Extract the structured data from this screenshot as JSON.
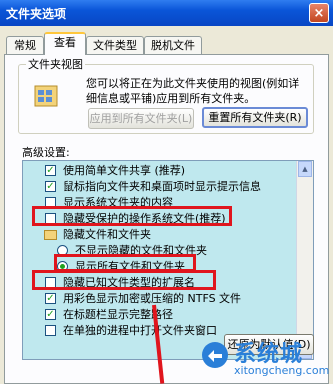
{
  "window": {
    "title": "文件夹选项",
    "close_glyph": "×"
  },
  "tabs": [
    {
      "label": "常规"
    },
    {
      "label": "查看"
    },
    {
      "label": "文件类型"
    },
    {
      "label": "脱机文件"
    }
  ],
  "folder_views": {
    "group_title": "文件夹视图",
    "description": "您可以将正在为此文件夹使用的视图(例如详细信息或平铺)应用到所有文件夹。",
    "apply_button": "应用到所有文件夹(L)",
    "reset_button": "重置所有文件夹(R)"
  },
  "advanced": {
    "label": "高级设置:",
    "items": [
      {
        "type": "checkbox",
        "checked": true,
        "text": "使用简单文件共享 (推荐)"
      },
      {
        "type": "checkbox",
        "checked": true,
        "text": "鼠标指向文件夹和桌面项时显示提示信息"
      },
      {
        "type": "checkbox",
        "checked": false,
        "text": "显示系统文件夹的内容"
      },
      {
        "type": "checkbox",
        "checked": false,
        "text": "隐藏受保护的操作系统文件(推荐)"
      },
      {
        "type": "folder",
        "text": "隐藏文件和文件夹"
      },
      {
        "type": "radio",
        "checked": false,
        "text": "不显示隐藏的文件和文件夹"
      },
      {
        "type": "radio",
        "checked": true,
        "text": "显示所有文件和文件夹"
      },
      {
        "type": "checkbox",
        "checked": false,
        "text": "隐藏已知文件类型的扩展名"
      },
      {
        "type": "checkbox",
        "checked": true,
        "text": "用彩色显示加密或压缩的 NTFS 文件"
      },
      {
        "type": "checkbox",
        "checked": true,
        "text": "在标题栏显示完整路径"
      },
      {
        "type": "checkbox",
        "checked": false,
        "text": "在单独的进程中打开文件夹窗口"
      }
    ],
    "restore_button": "还原为默认值(D)"
  },
  "watermark": {
    "name": "系统城",
    "url": "xitongcheng.com"
  },
  "colors": {
    "highlight": "#e0151d",
    "list_bg": "#bfe8ee",
    "titlebar": "#0a55d8"
  }
}
